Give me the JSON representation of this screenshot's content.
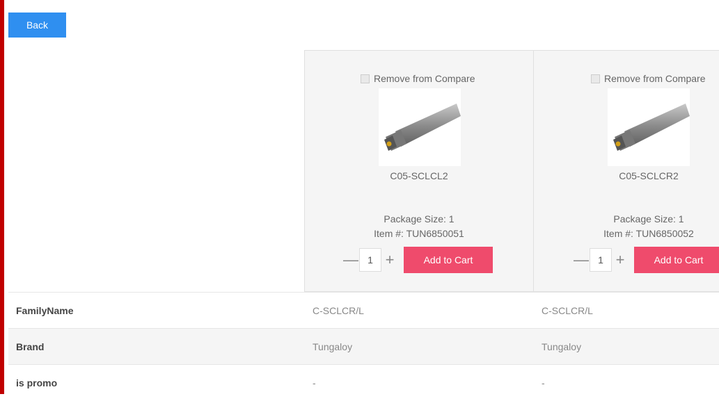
{
  "nav": {
    "back_label": "Back"
  },
  "products": [
    {
      "remove_label": "Remove from Compare",
      "sku": "C05-SCLCL2",
      "package_size": "Package Size: 1",
      "item_number": "Item #: TUN6850051",
      "quantity": "1",
      "add_to_cart_label": "Add to Cart"
    },
    {
      "remove_label": "Remove from Compare",
      "sku": "C05-SCLCR2",
      "package_size": "Package Size: 1",
      "item_number": "Item #: TUN6850052",
      "quantity": "1",
      "add_to_cart_label": "Add to Cart"
    }
  ],
  "attributes": [
    {
      "label": "FamilyName",
      "values": [
        "C-SCLCR/L",
        "C-SCLCR/L"
      ]
    },
    {
      "label": "Brand",
      "values": [
        "Tungaloy",
        "Tungaloy"
      ]
    },
    {
      "label": "is promo",
      "values": [
        "-",
        "-"
      ]
    }
  ],
  "colors": {
    "back_button": "#2f8ff0",
    "add_to_cart": "#ef4b6c",
    "left_border": "#c00000"
  },
  "icons": {
    "minus": "minus-icon",
    "plus": "plus-icon"
  }
}
